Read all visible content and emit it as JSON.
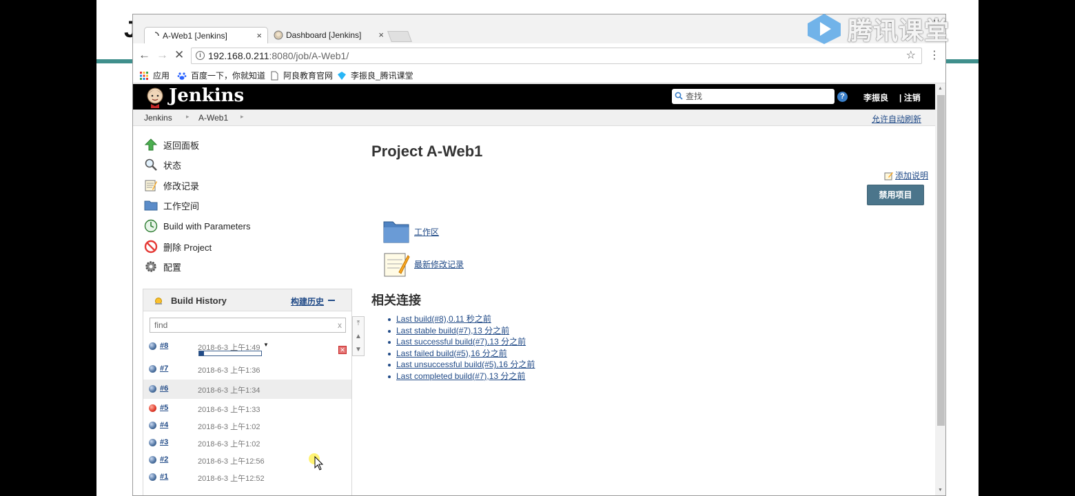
{
  "tabs": [
    {
      "title": "A-Web1 [Jenkins]",
      "close": "×",
      "active": true
    },
    {
      "title": "Dashboard [Jenkins]",
      "close": "×",
      "active": false
    }
  ],
  "watermark": {
    "text": "腾讯课堂"
  },
  "address_bar": {
    "host": "192.168.0.211",
    "path": ":8080/job/A-Web1/"
  },
  "bookmarks": [
    {
      "label": "应用",
      "icon": "apps-grid-icon"
    },
    {
      "label": "百度一下，你就知道",
      "icon": "baidu-paw-icon"
    },
    {
      "label": "阿良教育官网",
      "icon": "page-icon"
    },
    {
      "label": "李振良_腾讯课堂",
      "icon": "tencent-class-icon"
    }
  ],
  "jenkins": {
    "title": "Jenkins",
    "search_placeholder": "查找",
    "help": "?",
    "user": "李振良",
    "logout": "| 注销"
  },
  "breadcrumb": [
    "Jenkins",
    "A-Web1"
  ],
  "auto_refresh": "允许自动刷新",
  "sidebar": [
    {
      "label": "返回面板",
      "icon": "up-arrow-icon"
    },
    {
      "label": "状态",
      "icon": "magnifier-icon"
    },
    {
      "label": "修改记录",
      "icon": "notepad-icon"
    },
    {
      "label": "工作空间",
      "icon": "folder-icon"
    },
    {
      "label": "Build with Parameters",
      "icon": "clock-icon"
    },
    {
      "label": "删除 Project",
      "icon": "no-entry-icon"
    },
    {
      "label": "配置",
      "icon": "gear-icon"
    }
  ],
  "build_history": {
    "title": "Build History",
    "trend": "构建历史",
    "find_placeholder": "find",
    "clear": "x",
    "running_progress": 0.08,
    "builds": [
      {
        "num": "#8",
        "date": "2018-6-3 上午1:49",
        "status": "blue",
        "running": true
      },
      {
        "num": "#7",
        "date": "2018-6-3 上午1:36",
        "status": "blue"
      },
      {
        "num": "#6",
        "date": "2018-6-3 上午1:34",
        "status": "blue"
      },
      {
        "num": "#5",
        "date": "2018-6-3 上午1:33",
        "status": "red"
      },
      {
        "num": "#4",
        "date": "2018-6-3 上午1:02",
        "status": "blue"
      },
      {
        "num": "#3",
        "date": "2018-6-3 上午1:02",
        "status": "blue"
      },
      {
        "num": "#2",
        "date": "2018-6-3 上午12:56",
        "status": "blue"
      },
      {
        "num": "#1",
        "date": "2018-6-3 上午12:52",
        "status": "blue"
      }
    ]
  },
  "main": {
    "title": "Project A-Web1",
    "add_description": "添加说明",
    "disable_button": "禁用项目",
    "workspace_link": "工作区",
    "changes_link": "最新修改记录",
    "related_title": "相关连接",
    "related_links": [
      "Last build(#8),0.11 秒之前",
      "Last stable build(#7),13 分之前",
      "Last successful build(#7),13 分之前",
      "Last failed build(#5),16 分之前",
      "Last unsuccessful build(#5),16 分之前",
      "Last completed build(#7),13 分之前"
    ]
  }
}
